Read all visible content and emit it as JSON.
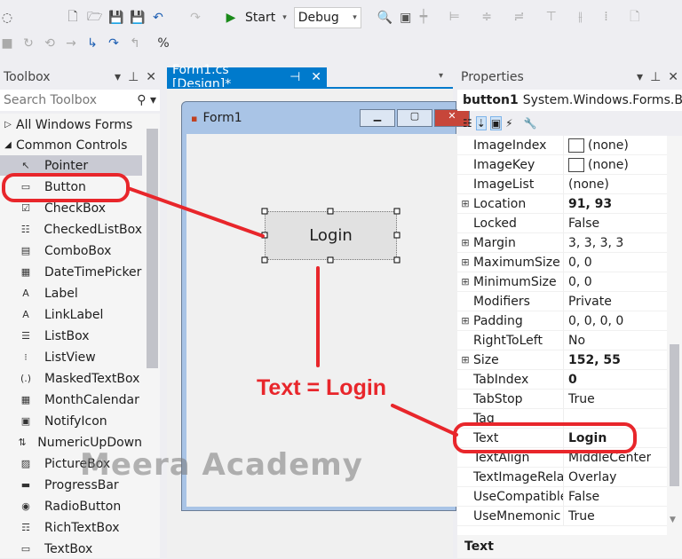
{
  "toolbar": {
    "start_label": "Start",
    "config_value": "Debug"
  },
  "toolbox": {
    "title": "Toolbox",
    "search_placeholder": "Search Toolbox",
    "groups": [
      {
        "label": "All Windows Forms",
        "expanded": false
      },
      {
        "label": "Common Controls",
        "expanded": true
      }
    ],
    "items": [
      {
        "label": "Pointer",
        "icon": "pointer-icon",
        "glyph": "↖"
      },
      {
        "label": "Button",
        "icon": "button-icon",
        "glyph": "▭"
      },
      {
        "label": "CheckBox",
        "icon": "checkbox-icon",
        "glyph": "☑"
      },
      {
        "label": "CheckedListBox",
        "icon": "checkedlistbox-icon",
        "glyph": "☷"
      },
      {
        "label": "ComboBox",
        "icon": "combobox-icon",
        "glyph": "▤"
      },
      {
        "label": "DateTimePicker",
        "icon": "datetimepicker-icon",
        "glyph": "▦"
      },
      {
        "label": "Label",
        "icon": "label-icon",
        "glyph": "A"
      },
      {
        "label": "LinkLabel",
        "icon": "linklabel-icon",
        "glyph": "A"
      },
      {
        "label": "ListBox",
        "icon": "listbox-icon",
        "glyph": "☰"
      },
      {
        "label": "ListView",
        "icon": "listview-icon",
        "glyph": "⁝"
      },
      {
        "label": "MaskedTextBox",
        "icon": "maskedtextbox-icon",
        "glyph": "(.)"
      },
      {
        "label": "MonthCalendar",
        "icon": "monthcalendar-icon",
        "glyph": "▦"
      },
      {
        "label": "NotifyIcon",
        "icon": "notifyicon-icon",
        "glyph": "▣"
      },
      {
        "label": "NumericUpDown",
        "icon": "numericupdown-icon",
        "glyph": "⇅"
      },
      {
        "label": "PictureBox",
        "icon": "picturebox-icon",
        "glyph": "▨"
      },
      {
        "label": "ProgressBar",
        "icon": "progressbar-icon",
        "glyph": "▬"
      },
      {
        "label": "RadioButton",
        "icon": "radiobutton-icon",
        "glyph": "◉"
      },
      {
        "label": "RichTextBox",
        "icon": "richtextbox-icon",
        "glyph": "☶"
      },
      {
        "label": "TextBox",
        "icon": "textbox-icon",
        "glyph": "▭"
      }
    ]
  },
  "designer": {
    "tab_label": "Form1.cs [Design]*",
    "form_title": "Form1",
    "button_text": "Login"
  },
  "properties": {
    "title": "Properties",
    "object_name": "button1",
    "object_type": "System.Windows.Forms.But",
    "rows": [
      {
        "name": "ImageIndex",
        "value": "(none)",
        "swatch": true
      },
      {
        "name": "ImageKey",
        "value": "(none)",
        "swatch": true
      },
      {
        "name": "ImageList",
        "value": "(none)"
      },
      {
        "name": "Location",
        "value": "91, 93",
        "bold": true,
        "expandable": true
      },
      {
        "name": "Locked",
        "value": "False"
      },
      {
        "name": "Margin",
        "value": "3, 3, 3, 3",
        "expandable": true
      },
      {
        "name": "MaximumSize",
        "value": "0, 0",
        "expandable": true
      },
      {
        "name": "MinimumSize",
        "value": "0, 0",
        "expandable": true
      },
      {
        "name": "Modifiers",
        "value": "Private"
      },
      {
        "name": "Padding",
        "value": "0, 0, 0, 0",
        "expandable": true
      },
      {
        "name": "RightToLeft",
        "value": "No"
      },
      {
        "name": "Size",
        "value": "152, 55",
        "bold": true,
        "expandable": true
      },
      {
        "name": "TabIndex",
        "value": "0",
        "bold": true
      },
      {
        "name": "TabStop",
        "value": "True"
      },
      {
        "name": "Tag",
        "value": ""
      },
      {
        "name": "Text",
        "value": "Login",
        "bold": true
      },
      {
        "name": "TextAlign",
        "value": "MiddleCenter"
      },
      {
        "name": "TextImageRelat",
        "value": "Overlay"
      },
      {
        "name": "UseCompatible",
        "value": "False"
      },
      {
        "name": "UseMnemonic",
        "value": "True"
      }
    ],
    "description_title": "Text"
  },
  "annotation": {
    "text": "Text = Login",
    "color": "#e8262b"
  },
  "watermark": "Meera Academy",
  "colors": {
    "accent": "#007acc",
    "annotation": "#e8262b"
  }
}
